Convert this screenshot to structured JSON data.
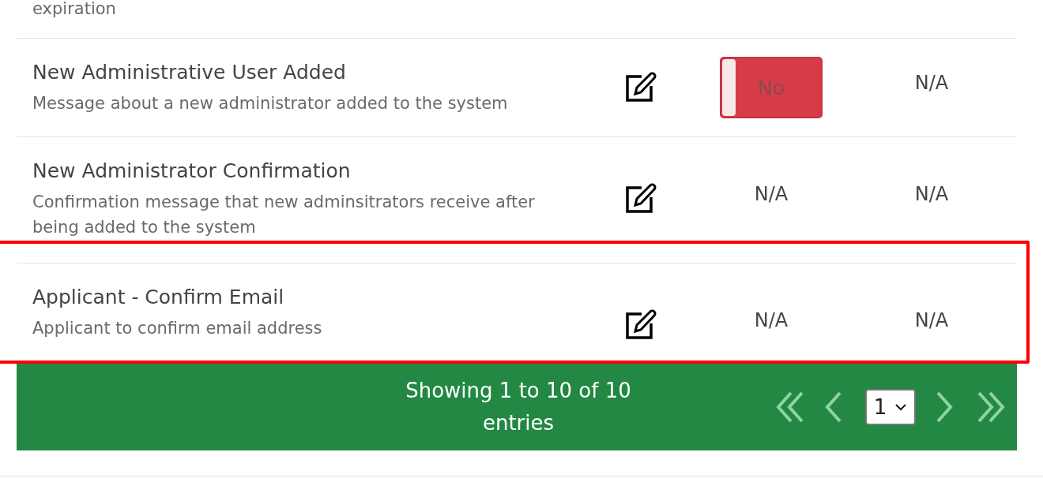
{
  "partial_row": {
    "description": "expiration"
  },
  "rows": [
    {
      "title": "New Administrative User Added",
      "description": "Message about a new administrator added to the system",
      "highlighted": false,
      "column_3": {
        "kind": "toggle",
        "on": false,
        "label": "No"
      },
      "column_4": "N/A"
    },
    {
      "title": "New Administrator Confirmation",
      "description": "Confirmation message that new adminsitrators receive after being added to the system",
      "highlighted": false,
      "column_3": {
        "kind": "text",
        "value": "N/A"
      },
      "column_4": "N/A"
    },
    {
      "title": "Applicant - Confirm Email",
      "description": "Applicant to confirm email address",
      "highlighted": true,
      "column_3": {
        "kind": "text",
        "value": "N/A"
      },
      "column_4": "N/A"
    }
  ],
  "footer": {
    "info": "Showing 1 to 10 of 10 entries",
    "page": "1"
  }
}
